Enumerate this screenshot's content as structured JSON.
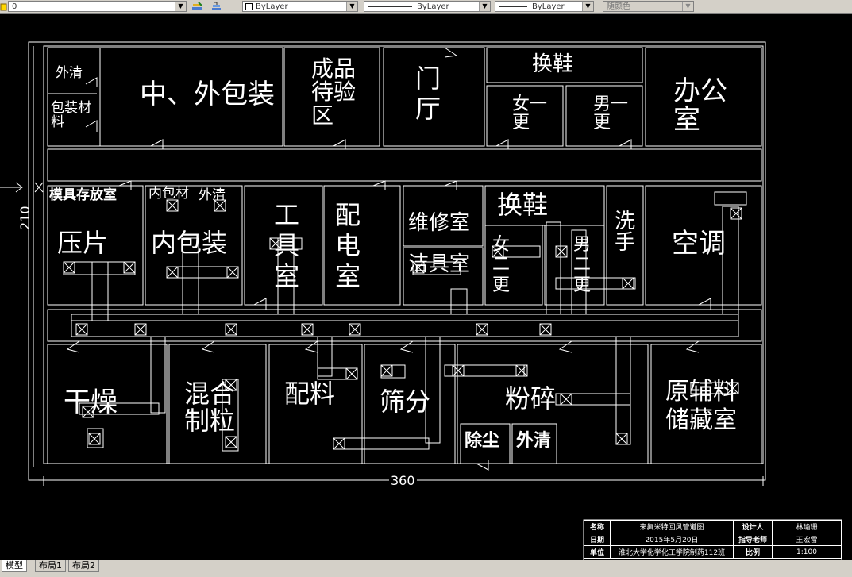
{
  "toolbar": {
    "layer_value": "0",
    "color_value": "ByLayer",
    "linetype_value": "ByLayer",
    "lineweight_value": "ByLayer",
    "plotstyle_value": "随颜色"
  },
  "dimensions": {
    "vertical": "210",
    "horizontal": "360"
  },
  "rooms": {
    "waiqing_top": "外清",
    "baozhuang_cailiao": "包装材料",
    "zhong_wai_baozhuang": "中、外包装",
    "chengpin": "成品待验区",
    "menting": "门厅",
    "huanxie_top": "换鞋",
    "nv_yigeng": "女一更",
    "nan_yigeng": "男一更",
    "bangongshi": "办公室",
    "muju": "模具存放室",
    "neibaocai": "内包材",
    "waiqing_mid": "外清",
    "yapian": "压片",
    "neibaozhuang": "内包装",
    "gongjushi": "工具室",
    "peidianshi": "配电室",
    "weixiushi": "维修室",
    "jiejushi": "洁具室",
    "huanxie_mid": "换鞋",
    "nv_ergeng": "女二更",
    "nan_ergeng": "男二更",
    "xishou": "洗手",
    "kongtiao": "空调",
    "ganzao": "干燥",
    "hunhe_zhili": "混合制粒",
    "peiliao": "配料",
    "shaifen": "筛分",
    "fensui": "粉碎",
    "chuchen": "除尘",
    "waiqing_bottom": "外清",
    "yuanfuliao": "原辅料储藏室"
  },
  "titleblock": {
    "name_label": "名称",
    "name_value": "来氟米特回风管道图",
    "designer_label": "设计人",
    "designer_value": "林瑜珊",
    "date_label": "日期",
    "date_value": "2015年5月20日",
    "advisor_label": "指导老师",
    "advisor_value": "王宏雷",
    "unit_label": "单位",
    "unit_value": "淮北大学化学化工学院制药112班",
    "scale_label": "比例",
    "scale_value": "1:100"
  },
  "tabs": [
    "模型",
    "布局1",
    "布局2"
  ]
}
